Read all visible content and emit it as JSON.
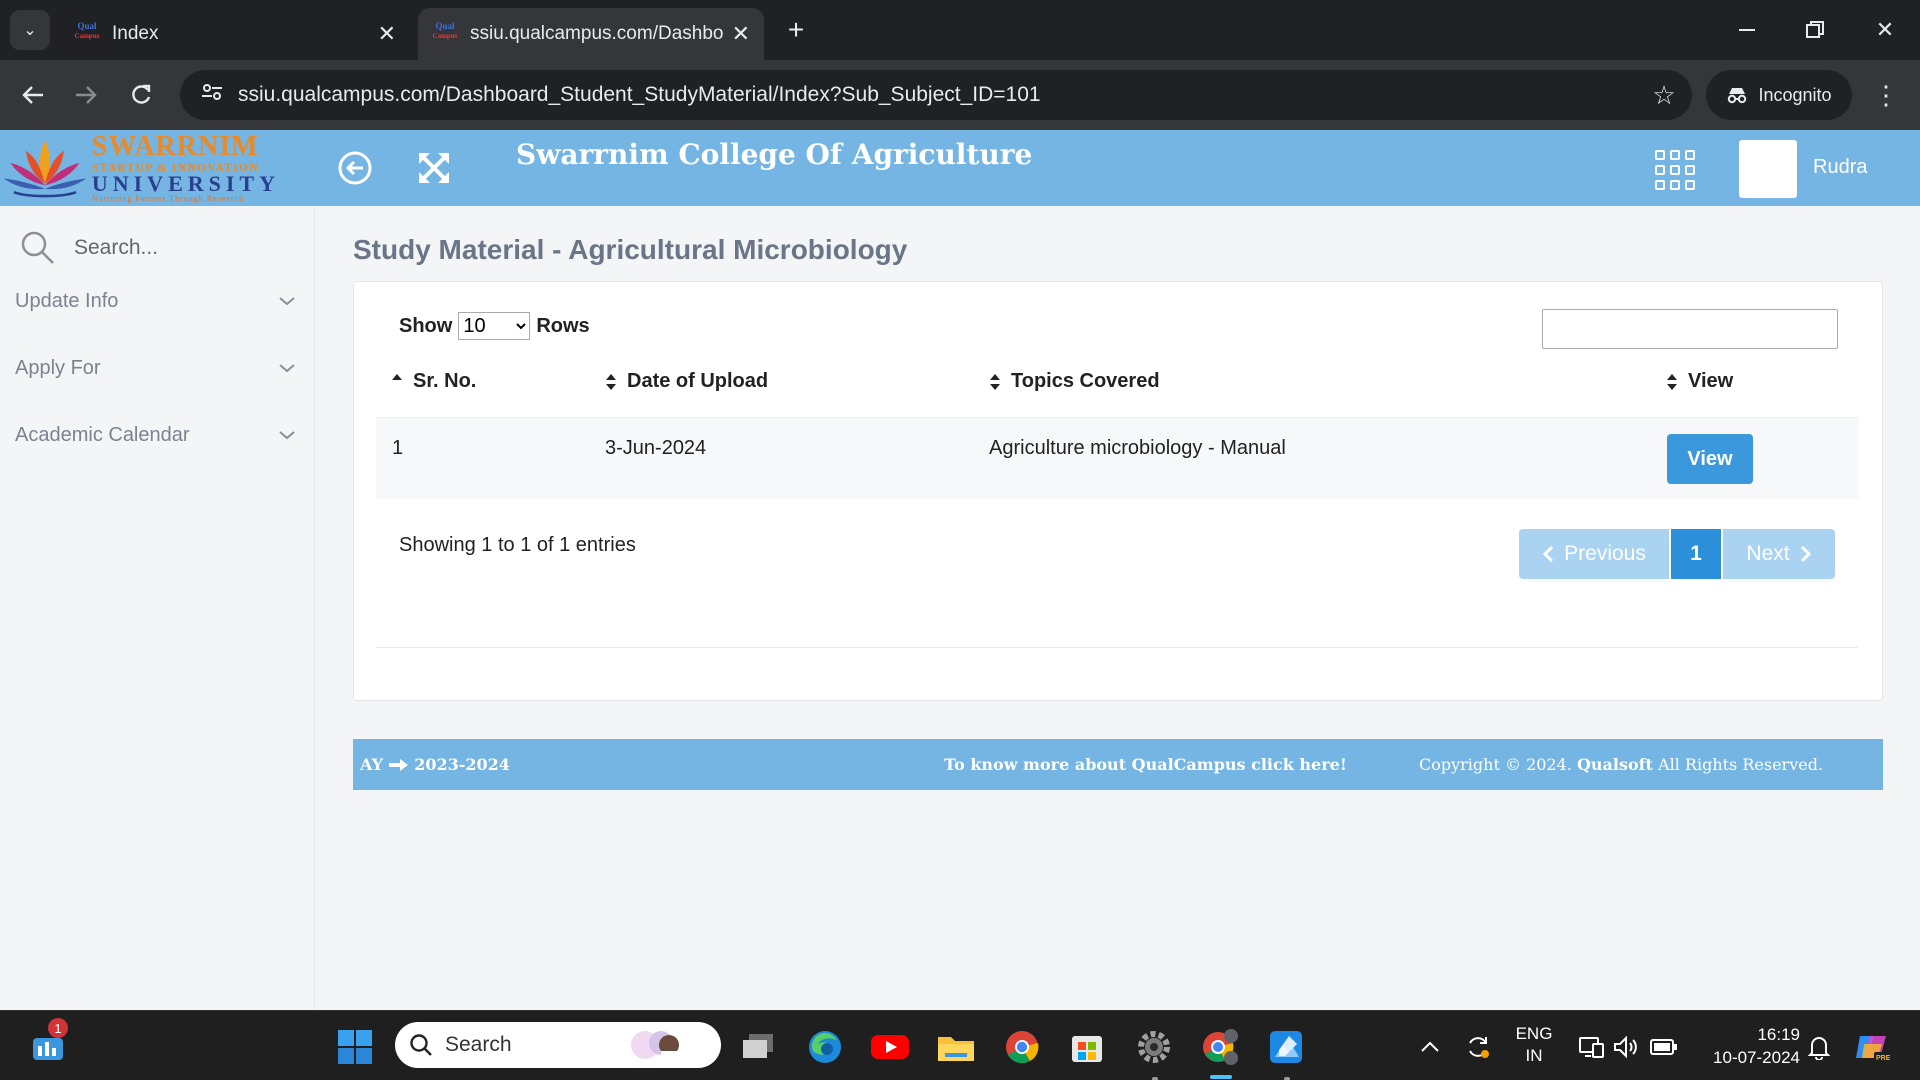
{
  "browser": {
    "tabs": [
      {
        "title": "Index",
        "favicon_label": "Qual",
        "favicon_sub": "Campus"
      },
      {
        "title": "ssiu.qualcampus.com/Dashboar",
        "favicon_label": "Qual",
        "favicon_sub": "Campus"
      }
    ],
    "url": "ssiu.qualcampus.com/Dashboard_Student_StudyMaterial/Index?Sub_Subject_ID=101",
    "incognito_label": "Incognito"
  },
  "header": {
    "brand_line1": "SWARRNIM",
    "brand_line2": "STARTUP & INNOVATION",
    "brand_line3": "UNIVERSITY",
    "brand_line4": "Nurturing Futures Through Research",
    "college_title": "Swarrnim College Of Agriculture",
    "username": "Rudra",
    "colors": {
      "header_bg": "#75b5e3",
      "accent": "#3b98dc"
    }
  },
  "sidebar": {
    "search_placeholder": "Search...",
    "items": [
      {
        "label": "Update Info"
      },
      {
        "label": "Apply For"
      },
      {
        "label": "Academic Calendar"
      }
    ]
  },
  "main": {
    "page_title": "Study Material - Agricultural Microbiology",
    "length": {
      "show_label": "Show",
      "rows_label": "Rows",
      "selected": "10",
      "options": [
        "10"
      ]
    },
    "columns": [
      "Sr. No.",
      "Date of Upload",
      "Topics Covered",
      "View"
    ],
    "rows": [
      {
        "sr_no": "1",
        "date": "3-Jun-2024",
        "topic": "Agriculture microbiology - Manual",
        "view_label": "View"
      }
    ],
    "info": "Showing 1 to 1 of 1 entries",
    "pagination": {
      "previous": "Previous",
      "current": "1",
      "next": "Next"
    }
  },
  "footer": {
    "ay_label": "AY",
    "ay_value": "2023-2024",
    "more_link": "To know more about QualCampus click here!",
    "copyright_prefix": "Copyright © 2024.",
    "copyright_brand": "Qualsoft",
    "copyright_suffix": "All Rights Reserved."
  },
  "taskbar": {
    "search_placeholder": "Search",
    "notification_count": "1",
    "language_line1": "ENG",
    "language_line2": "IN",
    "time": "16:19",
    "date": "10-07-2024"
  }
}
